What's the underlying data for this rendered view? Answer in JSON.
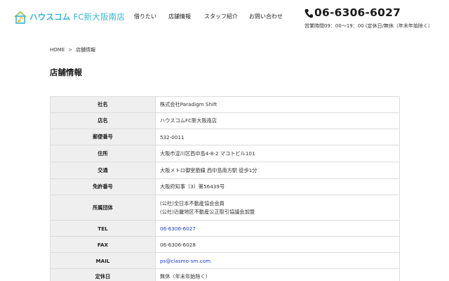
{
  "header": {
    "logo_brand": "ハウスコム",
    "logo_store": "FC新大阪南店",
    "nav": [
      {
        "label": "借りたい"
      },
      {
        "label": "店舗情報"
      },
      {
        "label": "スタッフ紹介"
      },
      {
        "label": "お問い合わせ"
      }
    ],
    "tel": "06-6306-6027",
    "hours": "営業時間09：00〜19：00 (定休日/無休（年末年始除く）"
  },
  "breadcrumb": {
    "home": "HOME",
    "separator": ">",
    "current": "店舗情報"
  },
  "page_title": "店舗情報",
  "table": {
    "rows": [
      {
        "label": "社名",
        "value": "株式会社Paradigm Shift"
      },
      {
        "label": "店名",
        "value": "ハウスコムFC新大阪南店"
      },
      {
        "label": "郵便番号",
        "value": "532-0011"
      },
      {
        "label": "住所",
        "value": "大阪市淀川区西中島4-8-2 マコトビル101"
      },
      {
        "label": "交通",
        "value": "大阪メトロ御堂筋線 西中島南方駅 徒歩1分"
      },
      {
        "label": "免許番号",
        "value": "大阪府知事（3）第56439号"
      },
      {
        "label": "所属団体",
        "value_lines": [
          "(公社)全日本不動産協会会員",
          "(公社)近畿地区不動産公正取引協議会加盟"
        ]
      },
      {
        "label": "TEL",
        "value": "06-6306-6027"
      },
      {
        "label": "FAX",
        "value": "06-6306-6028"
      },
      {
        "label": "MAIL",
        "value": "ps@clasmo-sm.com"
      },
      {
        "label": "定休日",
        "value": "無休（年末年始除く）"
      }
    ]
  },
  "colors": {
    "brand": "#3ab3d3",
    "link": "#1f3ec7",
    "table_header_bg": "#efefef",
    "table_border": "#dcdcdc"
  },
  "icons": {
    "logo": "house-music-note-logo-icon",
    "phone": "phone-icon",
    "breadcrumb_sep": "chevron-right-icon"
  }
}
